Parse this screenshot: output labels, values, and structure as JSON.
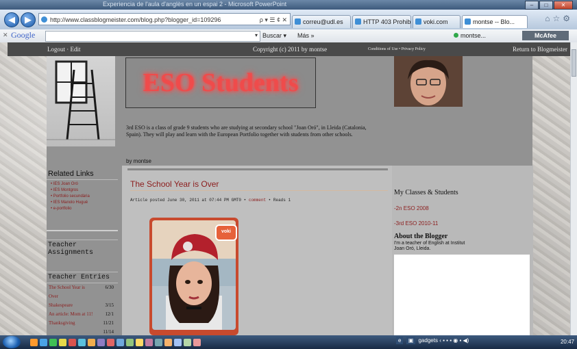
{
  "window": {
    "title": "Experiencia de l'aula d'anglès en un espai 2 - Microsoft PowerPoint"
  },
  "browser": {
    "url": "http://www.classblogmeister.com/blog.php?blogger_id=109296",
    "addr_controls": "ρ ▾ ☰ ¢ ✕",
    "tabs": [
      {
        "label": "correu@udl.es"
      },
      {
        "label": "HTTP 403 Prohibi..."
      },
      {
        "label": "voki.com"
      },
      {
        "label": "montse -- Blo..."
      }
    ]
  },
  "google_bar": {
    "logo": "Google",
    "search_label": "Buscar ▾",
    "more_label": "Más »",
    "user": "montse...",
    "mcafee": "McAfee"
  },
  "top_strip": {
    "logout": "Logout · Edit",
    "copyright": "Copyright (c) 2011 by montse",
    "conditions": "Conditions of Use  •  Privacy Policy",
    "return": "Return to Blogmeister"
  },
  "header": {
    "title": "ESO Students",
    "description": "3rd ESO is a class of grade 9 students who are studying at secondary school \"Joan Oró\", in Lleida (Catalonia, Spain). They will play and learn with the European Portfolio together with students from other schools.",
    "byline": "by montse"
  },
  "left": {
    "related_title": "Related Links",
    "related_links": [
      "• IES Joan Oró",
      "• IES Montgros",
      "• Portfolio secundària",
      "• IES Manolo Hugué",
      "• e-portfolio"
    ],
    "assignments_title": "Teacher Assignments",
    "entries_title": "Teacher Entries",
    "entries": [
      {
        "title": "The School Year is",
        "date": "6/30"
      },
      {
        "title": "Over",
        "date": ""
      },
      {
        "title": "Shakespeare",
        "date": "3/15"
      },
      {
        "title": "An article: Mom at 11!",
        "date": "12/1"
      },
      {
        "title": "Thanksgiving",
        "date": "11/21"
      },
      {
        "title": "",
        "date": "11/14"
      }
    ]
  },
  "post": {
    "title": "The School Year is Over",
    "meta_prefix": "Article posted June 30, 2011 at 07:44 PM GMT0 •",
    "comment": "comment",
    "meta_suffix": "• Reads 1",
    "voki_label": "voki"
  },
  "right": {
    "classes_title": "My Classes & Students",
    "class_links": [
      "-2n ESO 2008",
      "-3rd ESO 2010-11"
    ],
    "about_title": "About the Blogger",
    "about_text": "I'm a teacher of English at Institut Joan Oró, Lleida."
  },
  "taskbar": {
    "gadgets": "gadgets",
    "time": "20:47"
  }
}
